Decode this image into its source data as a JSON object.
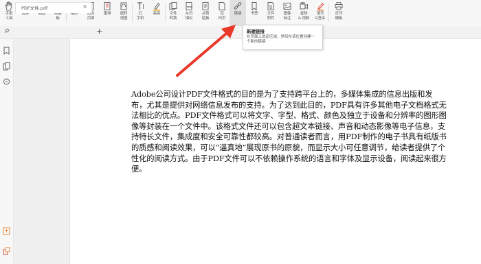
{
  "toolbar": {
    "items": [
      {
        "label": "手型\n工具",
        "icon": "hand-icon"
      },
      {
        "label": "选择",
        "icon": "select-text-icon"
      },
      {
        "label": "截图",
        "icon": "screenshot-icon"
      },
      {
        "label": "剪贴\n板",
        "icon": "clipboard-icon"
      },
      {
        "label": "缩放",
        "icon": "zoom-icon"
      },
      {
        "label": "适合\n页面",
        "icon": "fit-page-icon"
      },
      {
        "label": "重排",
        "icon": "reflow-icon"
      },
      {
        "label": "旋转\n视图",
        "icon": "rotate-view-icon"
      },
      {
        "label": "打\n字机",
        "icon": "typewriter-icon"
      },
      {
        "label": "高亮",
        "icon": "highlight-icon"
      },
      {
        "label": "文件\n转换",
        "icon": "file-convert-icon"
      },
      {
        "label": "从扫\n描仪",
        "icon": "scanner-icon"
      },
      {
        "label": "从剪\n贴板",
        "icon": "from-clipboard-icon"
      },
      {
        "label": "空\n白页",
        "icon": "blank-page-icon"
      },
      {
        "label": "链接",
        "icon": "link-icon"
      },
      {
        "label": "书签",
        "icon": "bookmark-icon"
      },
      {
        "label": "文件\n附件",
        "icon": "attachment-icon"
      },
      {
        "label": "图像\n标注",
        "icon": "image-annotation-icon"
      },
      {
        "label": "音频\n& 视频",
        "icon": "audio-video-icon"
      },
      {
        "label": "填写\n&签名",
        "icon": "fill-sign-icon"
      },
      {
        "label": "打印\n模板",
        "icon": "print-template-icon"
      }
    ]
  },
  "tab": {
    "title": "PDF文件.pdf",
    "close": "×",
    "add": "+"
  },
  "tooltip": {
    "title": "新建链接",
    "desc": "在页面上选定区域，然后在该位置创建一个新的链接"
  },
  "document": {
    "body": "Adobe公司设计PDF文件格式的目的是为了支持跨平台上的，多媒体集成的信息出版和发布，尤其是提供对网络信息发布的支持。为了达到此目的，PDF具有许多其他电子文档格式无法相比的优点。PDF文件格式可以将文字、字型、格式、颜色及独立于设备和分辨率的图形图像等封装在一个文件中。该格式文件还可以包含超文本链接、声音和动态影像等电子信息，支持特长文件，集成度和安全可靠性都较高。对普通读者而言，用PDF制作的电子书具有纸版书的质感和阅读效果，可以“逼真地”展现原书的原貌，而显示大小可任意调节，给读者提供了个性化的阅读方式。由于PDF文件可以不依赖操作系统的语言和字体及显示设备，阅读起来很方便。"
  },
  "colors": {
    "arrow": "#e8392a",
    "toolbar_bg": "#f7f7f7"
  }
}
